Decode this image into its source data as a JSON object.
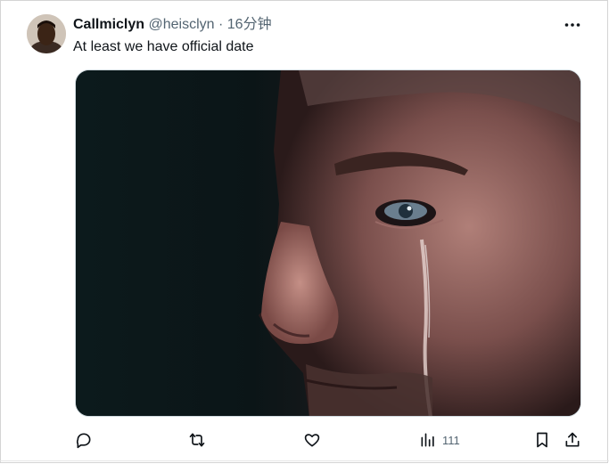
{
  "tweet": {
    "display_name": "Callmiclyn",
    "handle": "@heisclyn",
    "separator": "·",
    "time": "16分钟",
    "text": "At least we have official date"
  },
  "actions": {
    "views": "111"
  },
  "icons": {
    "more": "more-horizontal-icon",
    "reply": "reply-icon",
    "retweet": "retweet-icon",
    "like": "like-icon",
    "views": "views-chart-icon",
    "bookmark": "bookmark-icon",
    "share": "share-icon"
  },
  "colors": {
    "text": "#0f1419",
    "secondary": "#536471"
  }
}
